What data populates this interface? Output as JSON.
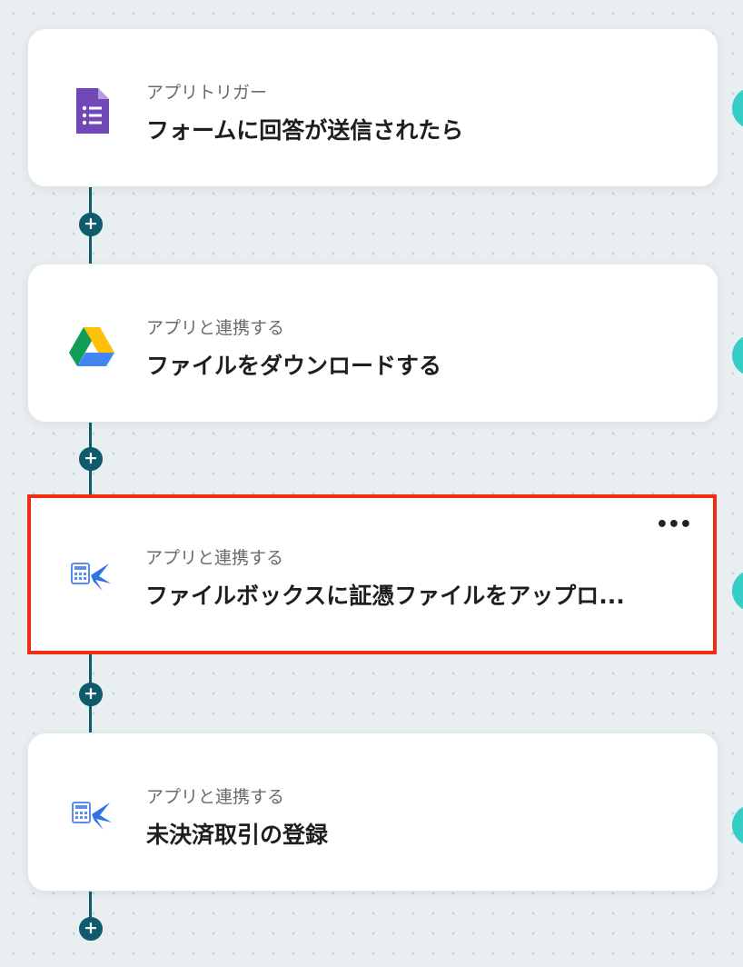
{
  "flow": {
    "steps": [
      {
        "label": "アプリトリガー",
        "title": "フォームに回答が送信されたら",
        "icon": "google-forms-icon"
      },
      {
        "label": "アプリと連携する",
        "title": "ファイルをダウンロードする",
        "icon": "google-drive-icon"
      },
      {
        "label": "アプリと連携する",
        "title": "ファイルボックスに証憑ファイルをアップロ...",
        "icon": "accounting-app-icon",
        "selected": true,
        "more": "•••"
      },
      {
        "label": "アプリと連携する",
        "title": "未決済取引の登録",
        "icon": "accounting-app-icon"
      }
    ],
    "add_step_symbol": "+"
  },
  "colors": {
    "connector": "#0f5b6e",
    "selected_border": "#ef2d10",
    "side_dot": "#35cdc5",
    "forms_purple": "#7248b9"
  }
}
